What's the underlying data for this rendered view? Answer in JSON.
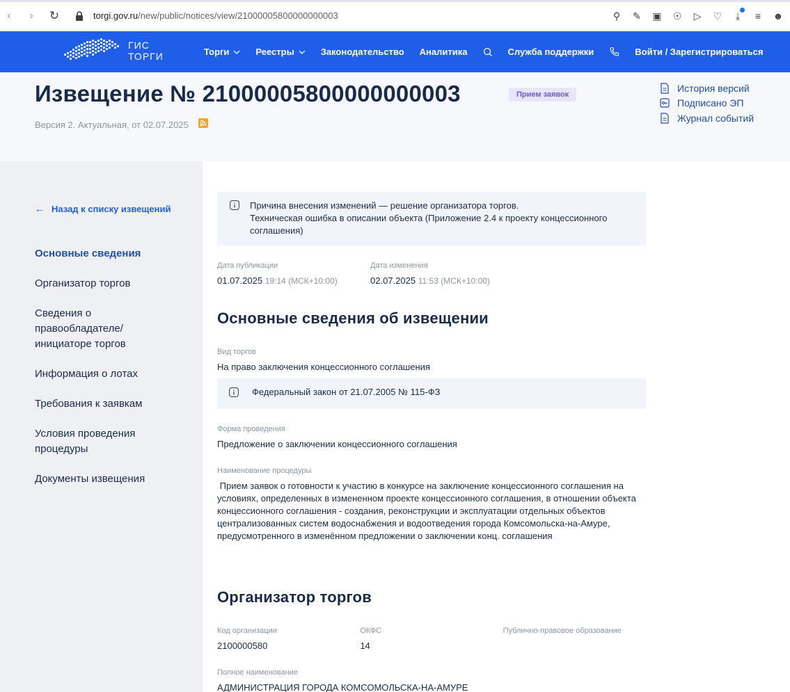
{
  "browser": {
    "url_host": "torgi.gov.ru",
    "url_path": "/new/public/notices/view/21000005800000000003"
  },
  "header": {
    "logo_line1": "ГИС",
    "logo_line2": "ТОРГИ",
    "nav": {
      "torgi": "Торги",
      "reestry": "Реестры",
      "zakon": "Законодательство",
      "analitika": "Аналитика",
      "support": "Служба поддержки",
      "login": "Войти / Зарегистрироваться"
    }
  },
  "notice": {
    "title": "Извещение № 21000005800000000003",
    "status": "Прием заявок",
    "version": "Версия 2. Актуальная, от 02.07.2025",
    "links": {
      "history": "История версий",
      "signed": "Подписано ЭП",
      "journal": "Журнал событий"
    }
  },
  "sidebar": {
    "back": "Назад к списку извещений",
    "items": [
      "Основные сведения",
      "Организатор торгов",
      "Сведения о правообладателе/ инициаторе торгов",
      "Информация о лотах",
      "Требования к заявкам",
      "Условия проведения процедуры",
      "Документы извещения"
    ]
  },
  "change_reason": {
    "line1": "Причина внесения изменений — решение организатора торгов.",
    "line2": "Техническая ошибка в описании объекта (Приложение 2.4 к проекту концессионного соглашения)"
  },
  "dates": {
    "pub_label": "Дата публикации",
    "pub_date": "01.07.2025",
    "pub_time": "19:14 (МСК+10:00)",
    "mod_label": "Дата изменения",
    "mod_date": "02.07.2025",
    "mod_time": "11:53 (МСК+10:00)"
  },
  "main_info": {
    "title": "Основные сведения об извещении",
    "type_label": "Вид торгов",
    "type_value": "На право заключения концессионного соглашения",
    "law": "Федеральный закон от 21.07.2005 № 115-ФЗ",
    "form_label": "Форма проведения",
    "form_value": "Предложение о заключении концессионного соглашения",
    "name_label": "Наименование процедуры",
    "name_value": " Прием заявок о готовности к участию в конкурсе на заключение концессионного соглашения на условиях, определенных в измененном проекте концессионного соглашения, в отношении объекта концессионного соглашения - создания, реконструкции и эксплуатации отдельных объектов централизованных систем водоснабжения и водоотведения города Комсомольска-на-Амуре, предусмотренного в изменённом предложении о заключении конц. соглашения"
  },
  "organizer": {
    "title": "Организатор торгов",
    "code_label": "Код организации",
    "code_value": "2100000580",
    "okfs_label": "ОКФС",
    "okfs_value": "14",
    "ppo_label": "Публично-правовое образование",
    "fullname_label": "Полное наименование",
    "fullname_value": "АДМИНИСТРАЦИЯ ГОРОДА КОМСОМОЛЬСКА-НА-АМУРЕ"
  },
  "colors": {
    "brand_blue": "#1f5ee8",
    "title_dark": "#1a2b4a",
    "badge_bg": "#e8e4fb",
    "badge_text": "#6b5bd6",
    "rss": "#f4a52a"
  }
}
